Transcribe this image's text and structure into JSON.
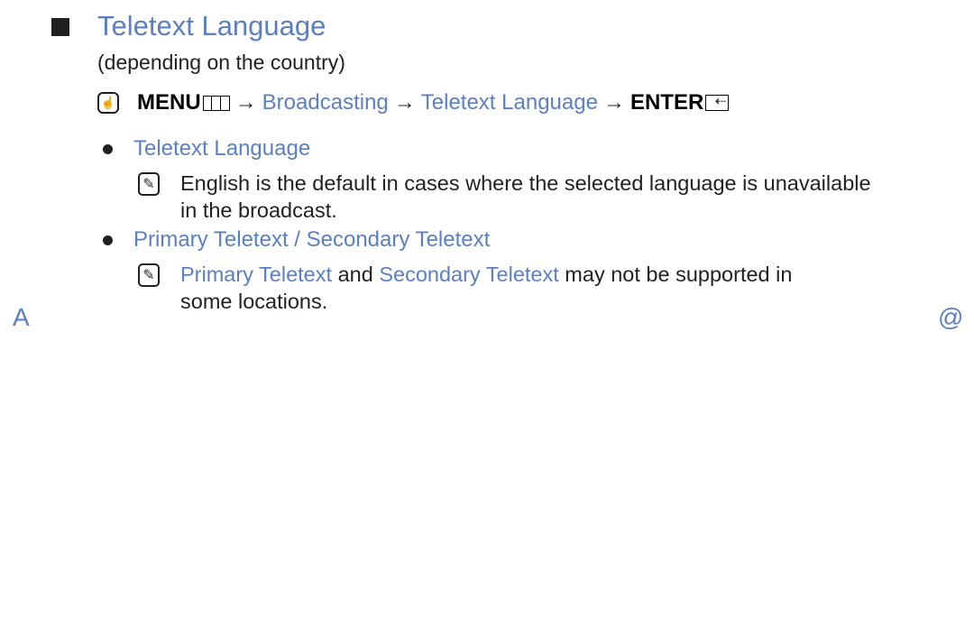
{
  "section": {
    "title": "Teletext Language",
    "subtitle": "(depending on the country)"
  },
  "menu_path": {
    "menu_label": "MENU",
    "arrow": "→",
    "step1": "Broadcasting",
    "step2": "Teletext Language",
    "enter_label": "ENTER"
  },
  "items": [
    {
      "heading": "Teletext Language",
      "note_line1": "English is the default in cases where the selected language is unavailable",
      "note_line2": "in the broadcast."
    },
    {
      "heading": "Primary Teletext / Secondary Teletext",
      "note_term1": "Primary Teletext",
      "note_and": " and ",
      "note_term2": "Secondary Teletext",
      "note_rest": " may not be supported in",
      "note_line2": "some locations."
    }
  ],
  "nav": {
    "left_mark": "A",
    "right_mark": "@"
  },
  "colors": {
    "accent": "#5b7fc1",
    "text": "#231f20"
  }
}
